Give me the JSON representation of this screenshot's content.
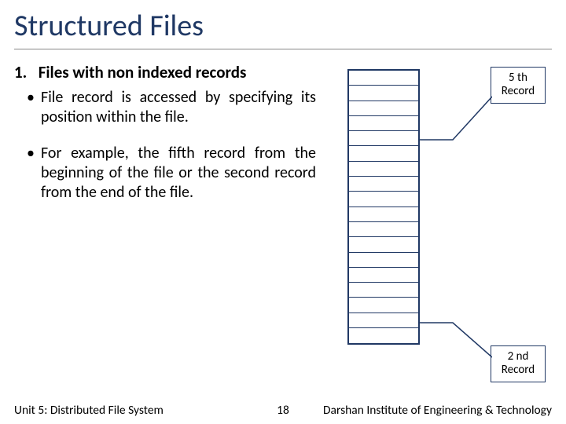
{
  "title": "Structured Files",
  "section": {
    "num": "1.",
    "heading": "Files with non indexed records"
  },
  "bullets": [
    "File record is accessed by specifying its position within the file.",
    "For example, the fifth record from the beginning of the file or the second record from the end of the file."
  ],
  "callouts": {
    "top": "5 th Record",
    "bottom": "2 nd Record"
  },
  "records": {
    "count": 18
  },
  "footer": {
    "left": "Unit 5: Distributed File System",
    "center": "18",
    "right": "Darshan Institute of Engineering & Technology"
  }
}
